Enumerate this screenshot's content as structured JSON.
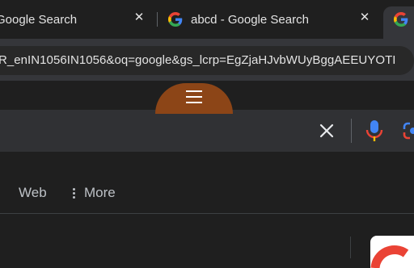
{
  "tabs": [
    {
      "title": "Google Search",
      "close_glyph": "✕"
    },
    {
      "title": "abcd - Google Search",
      "close_glyph": "✕"
    },
    {
      "title": ""
    }
  ],
  "omnibox": {
    "url": "R_enIN1056IN1056&oq=google&gs_lcrp=EgZjaHJvbWUyBggAEEUYOTI"
  },
  "search": {
    "clear_glyph": "✕"
  },
  "nav": {
    "web_label": "Web",
    "more_label": "More"
  },
  "icons": {
    "google_logo": "google-g-icon",
    "menu": "hamburger-icon",
    "clear": "close-icon",
    "voice": "mic-icon",
    "lens": "camera-lens-icon",
    "more": "kebab-icon"
  },
  "colors": {
    "background": "#1f1f1f",
    "toolbar": "#35363a",
    "searchbox": "#303134",
    "menu_handle": "#8c4517",
    "google_blue": "#4285f4",
    "google_red": "#ea4335",
    "google_yellow": "#fbbc05",
    "google_green": "#34a853"
  }
}
